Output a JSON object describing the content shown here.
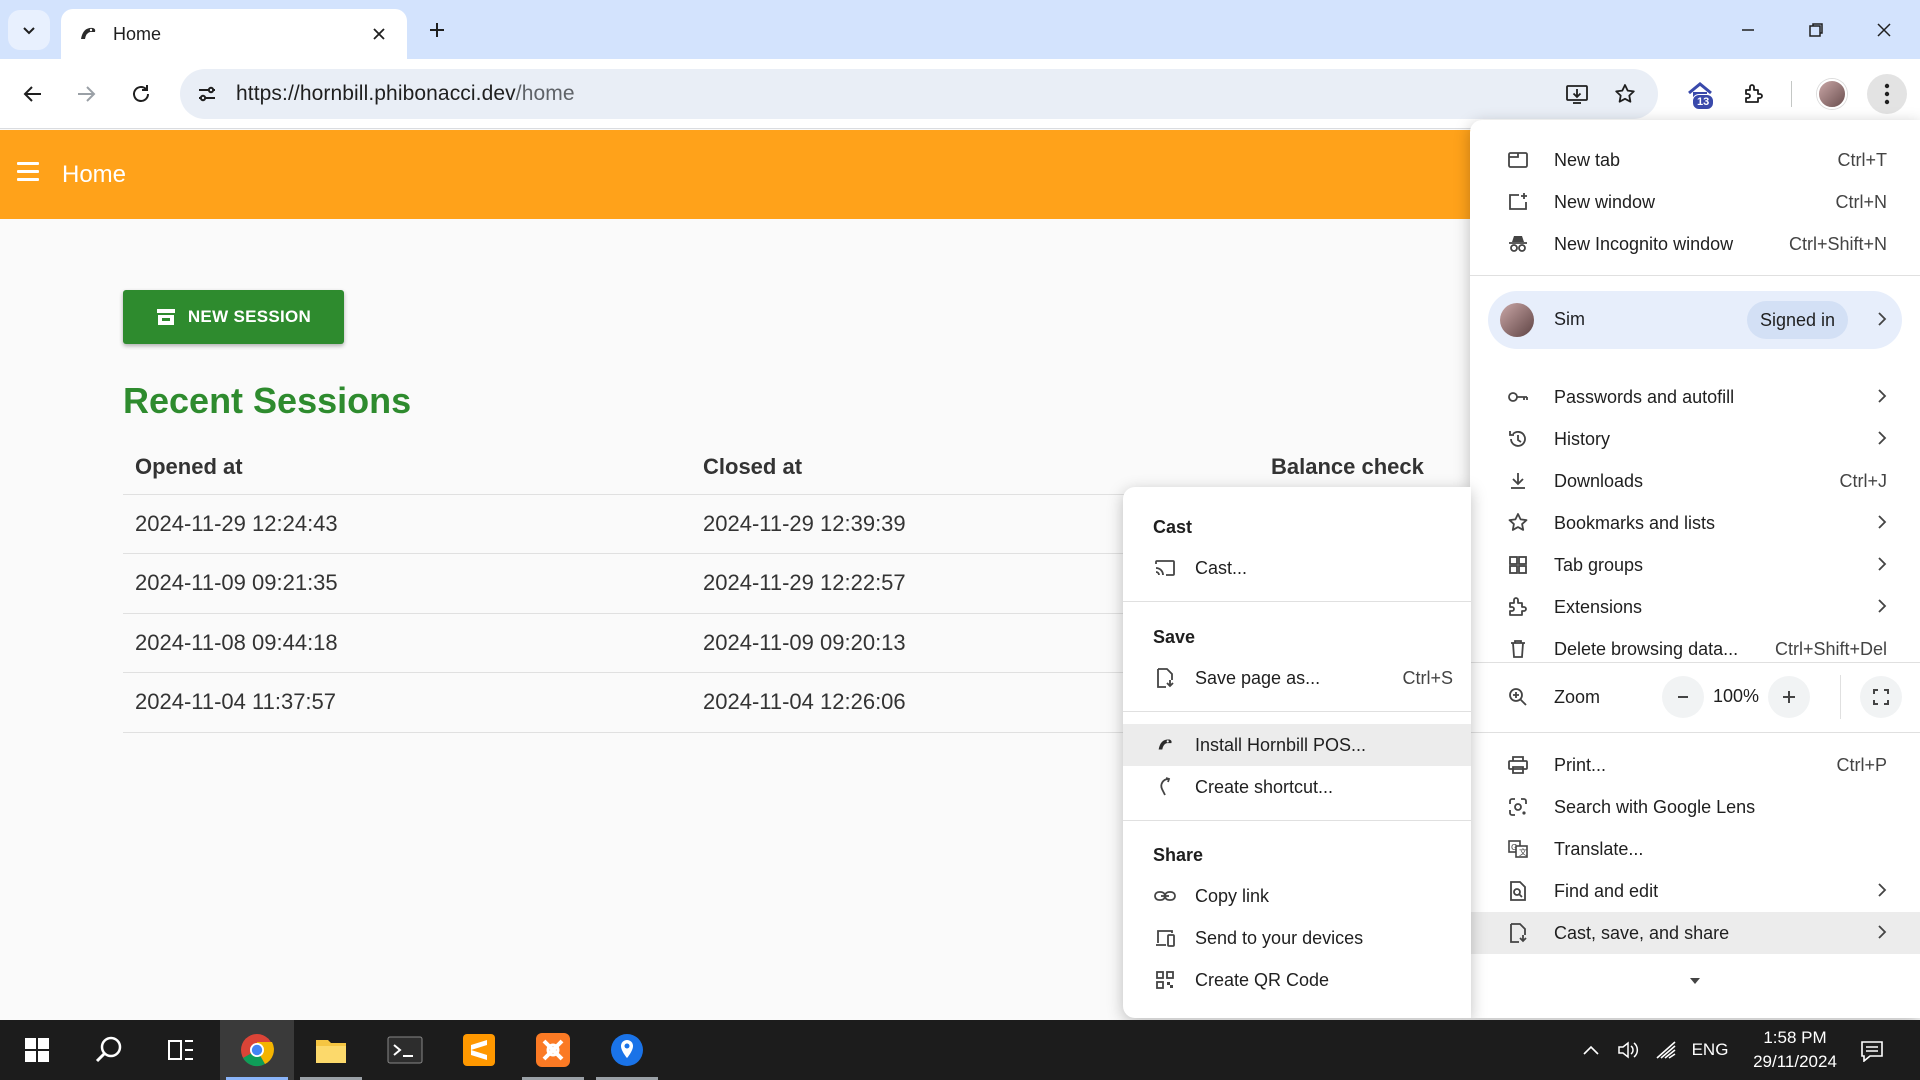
{
  "browser": {
    "tab": {
      "title": "Home"
    },
    "url": {
      "host": "https://hornbill.phibonacci.dev",
      "path": "/home"
    },
    "extension_badge": "13"
  },
  "app": {
    "title": "Home",
    "new_session_label": "NEW SESSION",
    "recent_title": "Recent Sessions",
    "columns": [
      "Opened at",
      "Closed at",
      "Balance check"
    ],
    "rows": [
      {
        "opened": "2024-11-29 12:24:43",
        "closed": "2024-11-29 12:39:39"
      },
      {
        "opened": "2024-11-09 09:21:35",
        "closed": "2024-11-29 12:22:57"
      },
      {
        "opened": "2024-11-08 09:44:18",
        "closed": "2024-11-09 09:20:13"
      },
      {
        "opened": "2024-11-04 11:37:57",
        "closed": "2024-11-04 12:26:06"
      }
    ]
  },
  "menu": {
    "new_tab": {
      "label": "New tab",
      "shortcut": "Ctrl+T"
    },
    "new_window": {
      "label": "New window",
      "shortcut": "Ctrl+N"
    },
    "incognito": {
      "label": "New Incognito window",
      "shortcut": "Ctrl+Shift+N"
    },
    "profile": {
      "name": "Sim",
      "status": "Signed in"
    },
    "passwords": {
      "label": "Passwords and autofill"
    },
    "history": {
      "label": "History"
    },
    "downloads": {
      "label": "Downloads",
      "shortcut": "Ctrl+J"
    },
    "bookmarks": {
      "label": "Bookmarks and lists"
    },
    "tab_groups": {
      "label": "Tab groups"
    },
    "extensions": {
      "label": "Extensions"
    },
    "delete_data": {
      "label": "Delete browsing data...",
      "shortcut": "Ctrl+Shift+Del"
    },
    "zoom": {
      "label": "Zoom",
      "value": "100%"
    },
    "print": {
      "label": "Print...",
      "shortcut": "Ctrl+P"
    },
    "lens": {
      "label": "Search with Google Lens"
    },
    "translate": {
      "label": "Translate..."
    },
    "find_edit": {
      "label": "Find and edit"
    },
    "cast_save_share": {
      "label": "Cast, save, and share"
    }
  },
  "submenu": {
    "cast_heading": "Cast",
    "cast": "Cast...",
    "save_heading": "Save",
    "save_page": {
      "label": "Save page as...",
      "shortcut": "Ctrl+S"
    },
    "install": "Install Hornbill POS...",
    "shortcut": "Create shortcut...",
    "share_heading": "Share",
    "copy_link": "Copy link",
    "send_devices": "Send to your devices",
    "qr": "Create QR Code"
  },
  "taskbar": {
    "language": "ENG",
    "time": "1:58 PM",
    "date": "29/11/2024"
  },
  "colors": {
    "appbar": "#ffa21a",
    "primary_green": "#2e8b2e",
    "tabstrip": "#d3e3fd"
  }
}
